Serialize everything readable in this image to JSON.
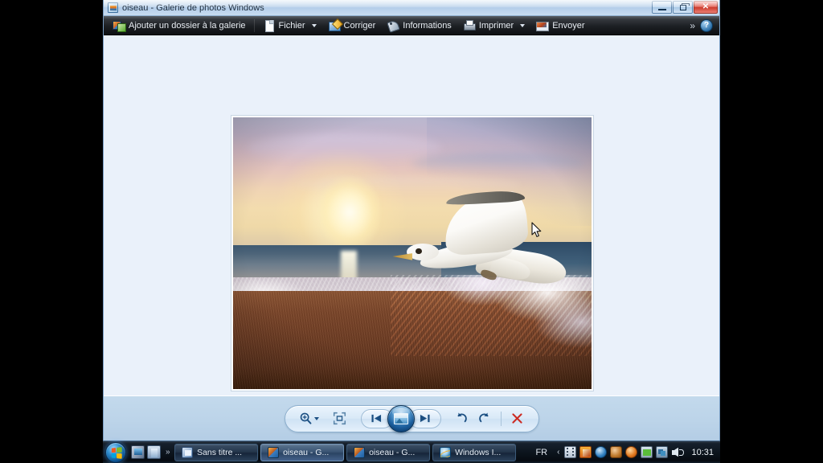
{
  "window": {
    "title": "oiseau - Galerie de photos Windows",
    "app_icon": "photo-gallery-icon",
    "controls": {
      "minimize": "Réduire",
      "restore": "Agrandir",
      "close": "Fermer"
    }
  },
  "toolbar": {
    "items": [
      {
        "label": "Ajouter un dossier à la galerie",
        "icon": "add-folder-icon",
        "dropdown": false
      },
      {
        "label": "Fichier",
        "icon": "file-icon",
        "dropdown": true
      },
      {
        "label": "Corriger",
        "icon": "fix-icon",
        "dropdown": false
      },
      {
        "label": "Informations",
        "icon": "info-tag-icon",
        "dropdown": false
      },
      {
        "label": "Imprimer",
        "icon": "printer-icon",
        "dropdown": true
      },
      {
        "label": "Envoyer",
        "icon": "send-mail-icon",
        "dropdown": false
      }
    ],
    "overflow": "»",
    "help": "?"
  },
  "photo": {
    "name": "oiseau",
    "alt": "Mouette blanche en vol au-dessus d'une plage au coucher du soleil"
  },
  "controlbar": {
    "zoom": {
      "label": "Zoom",
      "icon": "magnifier-plus-icon",
      "dropdown": true
    },
    "fit": {
      "label": "Ajuster à la fenêtre",
      "icon": "fit-to-window-icon"
    },
    "previous": {
      "label": "Précédent",
      "icon": "skip-back-icon"
    },
    "slideshow": {
      "label": "Diaporama",
      "icon": "slideshow-picture-icon"
    },
    "next": {
      "label": "Suivant",
      "icon": "skip-forward-icon"
    },
    "rotate_ccw": {
      "label": "Faire pivoter à gauche",
      "icon": "rotate-ccw-icon"
    },
    "rotate_cw": {
      "label": "Faire pivoter à droite",
      "icon": "rotate-cw-icon"
    },
    "delete": {
      "label": "Supprimer",
      "icon": "delete-x-icon",
      "color": "#cc2b22"
    }
  },
  "taskbar": {
    "start": {
      "label": "Démarrer",
      "icon": "windows-start-orb"
    },
    "quicklaunch": [
      {
        "label": "Windows Media Player",
        "icon": "media-player-icon"
      },
      {
        "label": "Explorateur Windows",
        "icon": "folder-icon"
      }
    ],
    "quicklaunch_overflow": "»",
    "buttons": [
      {
        "label": "Sans titre ...",
        "icon": "wordpad-icon",
        "active": false
      },
      {
        "label": "oiseau - G...",
        "icon": "photo-gallery-icon",
        "active": true
      },
      {
        "label": "oiseau - G...",
        "icon": "photo-gallery-icon",
        "active": false
      },
      {
        "label": "Windows I...",
        "icon": "internet-explorer-icon",
        "active": false
      }
    ],
    "language": "FR",
    "tray_expand": "‹",
    "tray": [
      {
        "icon": "film-icon"
      },
      {
        "icon": "orange-app-icon"
      },
      {
        "icon": "blue-app-icon"
      },
      {
        "icon": "brown-app-icon"
      },
      {
        "icon": "amber-app-icon"
      },
      {
        "icon": "battery-icon"
      },
      {
        "icon": "network-icon"
      },
      {
        "icon": "volume-icon"
      }
    ],
    "clock": "10:31"
  }
}
